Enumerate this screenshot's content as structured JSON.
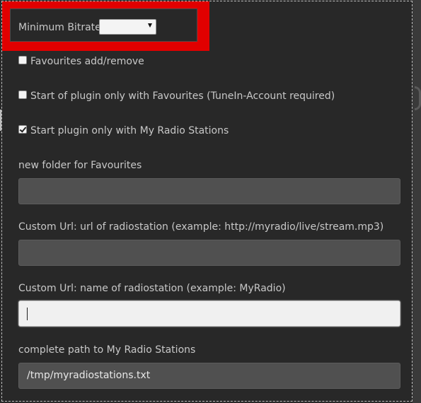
{
  "bitrate": {
    "label": "Minimum Bitrate",
    "selected_value": ""
  },
  "checkboxes": [
    {
      "label": "Favourites add/remove",
      "checked": false
    },
    {
      "label": "Start of plugin only with Favourites (TuneIn-Account required)",
      "checked": false
    },
    {
      "label": "Start plugin only with My Radio Stations",
      "checked": true
    }
  ],
  "fields": {
    "favourites_folder": {
      "label": "new folder for Favourites",
      "value": ""
    },
    "custom_url": {
      "label": "Custom Url: url of radiostation (example: http://myradio/live/stream.mp3)",
      "value": ""
    },
    "custom_name": {
      "label": "Custom Url: name of radiostation (example: MyRadio)",
      "value": ""
    },
    "stations_path": {
      "label": "complete path to My Radio Stations",
      "value": "/tmp/myradiostations.txt"
    }
  },
  "colors": {
    "highlight": "#e10000",
    "dialog_bg": "#282828",
    "input_bg": "#505050",
    "focused_input_bg": "#f0f0f0",
    "text": "#c8c8c8"
  }
}
